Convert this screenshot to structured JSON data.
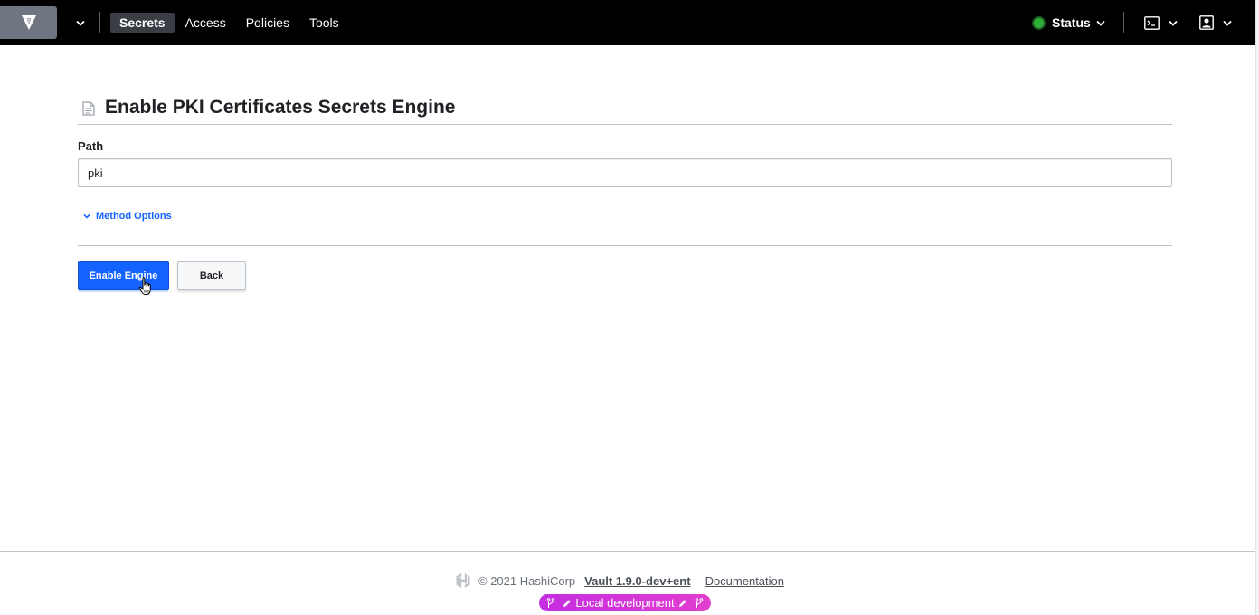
{
  "nav": {
    "items": [
      {
        "label": "Secrets",
        "active": true
      },
      {
        "label": "Access",
        "active": false
      },
      {
        "label": "Policies",
        "active": false
      },
      {
        "label": "Tools",
        "active": false
      }
    ],
    "status_label": "Status",
    "status_color": "#2eb039"
  },
  "page": {
    "title": "Enable PKI Certificates Secrets Engine",
    "path_label": "Path",
    "path_value": "pki",
    "method_options_label": "Method Options",
    "enable_button_label": "Enable Engine",
    "back_button_label": "Back"
  },
  "footer": {
    "copyright": "© 2021 HashiCorp",
    "version_link": "Vault 1.9.0-dev+ent",
    "docs_link": "Documentation",
    "env_badge": "Local development"
  },
  "colors": {
    "primary": "#1563ff",
    "topbar": "#000000",
    "badge": "#d929e0"
  },
  "icons": [
    "vault-logo-icon",
    "chevron-down-icon",
    "terminal-icon",
    "user-icon",
    "document-icon",
    "hashicorp-logo-icon",
    "branch-icon",
    "pencil-icon"
  ]
}
